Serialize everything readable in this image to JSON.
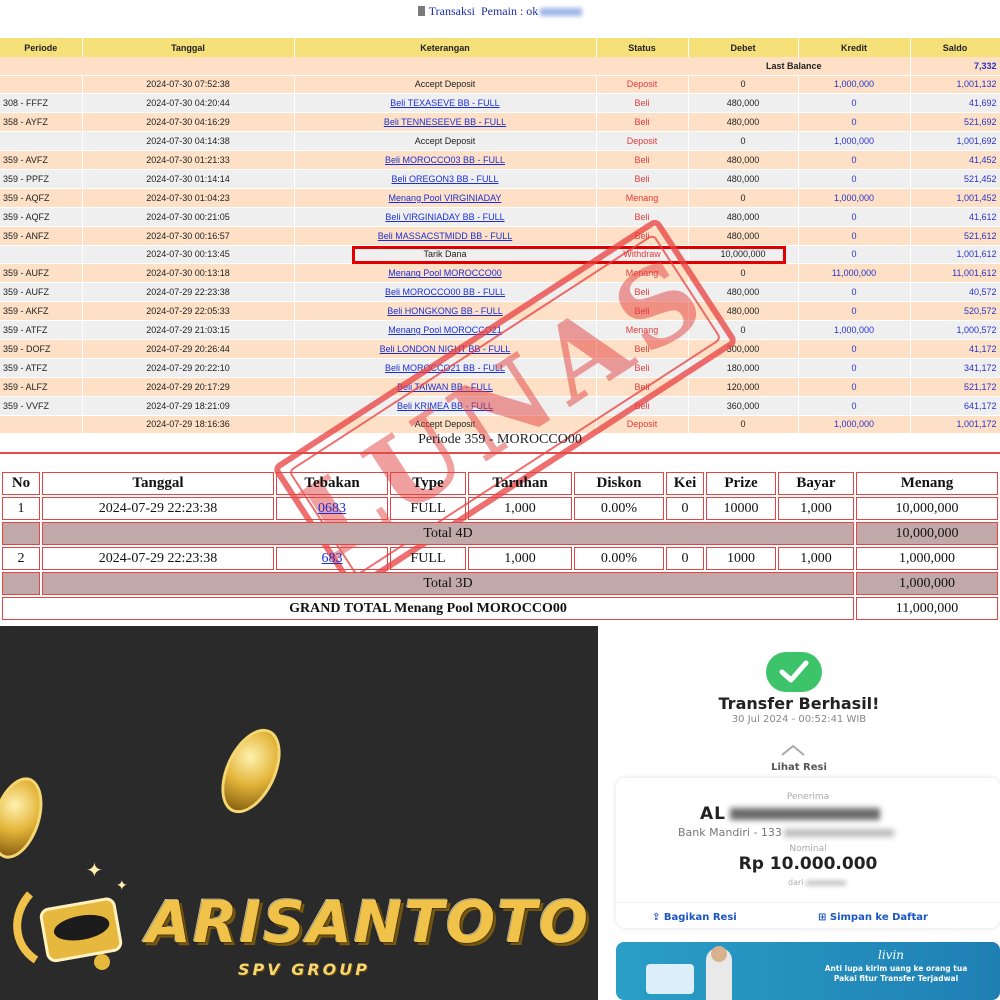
{
  "header": {
    "title": "Transaksi",
    "player_label": "Pemain : ok"
  },
  "ledger": {
    "columns": [
      "Periode",
      "Tanggal",
      "Keterangan",
      "Status",
      "Debet",
      "Kredit",
      "Saldo"
    ],
    "last_balance_label": "Last Balance",
    "last_balance_value": "7,332",
    "rows": [
      {
        "periode": "",
        "tanggal": "2024-07-30 07:52:38",
        "keterangan": "Accept Deposit",
        "link": false,
        "status": "Deposit",
        "debet": "0",
        "kredit": "1,000,000",
        "saldo": "1,001,132"
      },
      {
        "periode": "308 - FFFZ",
        "tanggal": "2024-07-30 04:20:44",
        "keterangan": "Beli TEXASEVE BB - FULL",
        "link": true,
        "status": "Beli",
        "debet": "480,000",
        "kredit": "0",
        "saldo": "41,692"
      },
      {
        "periode": "358 - AYFZ",
        "tanggal": "2024-07-30 04:16:29",
        "keterangan": "Beli TENNESEEVE BB - FULL",
        "link": true,
        "status": "Beli",
        "debet": "480,000",
        "kredit": "0",
        "saldo": "521,692"
      },
      {
        "periode": "",
        "tanggal": "2024-07-30 04:14:38",
        "keterangan": "Accept Deposit",
        "link": false,
        "status": "Deposit",
        "debet": "0",
        "kredit": "1,000,000",
        "saldo": "1,001,692"
      },
      {
        "periode": "359 - AVFZ",
        "tanggal": "2024-07-30 01:21:33",
        "keterangan": "Beli MOROCCO03 BB - FULL",
        "link": true,
        "status": "Beli",
        "debet": "480,000",
        "kredit": "0",
        "saldo": "41,452"
      },
      {
        "periode": "359 - PPFZ",
        "tanggal": "2024-07-30 01:14:14",
        "keterangan": "Beli OREGON3 BB - FULL",
        "link": true,
        "status": "Beli",
        "debet": "480,000",
        "kredit": "0",
        "saldo": "521,452"
      },
      {
        "periode": "359 - AQFZ",
        "tanggal": "2024-07-30 01:04:23",
        "keterangan": "Menang Pool VIRGINIADAY",
        "link": true,
        "status": "Menang",
        "debet": "0",
        "kredit": "1,000,000",
        "saldo": "1,001,452"
      },
      {
        "periode": "359 - AQFZ",
        "tanggal": "2024-07-30 00:21:05",
        "keterangan": "Beli VIRGINIADAY BB - FULL",
        "link": true,
        "status": "Beli",
        "debet": "480,000",
        "kredit": "0",
        "saldo": "41,612"
      },
      {
        "periode": "359 - ANFZ",
        "tanggal": "2024-07-30 00:16:57",
        "keterangan": "Beli MASSACSTMIDD BB - FULL",
        "link": true,
        "status": "Beli",
        "debet": "480,000",
        "kredit": "0",
        "saldo": "521,612"
      },
      {
        "periode": "",
        "tanggal": "2024-07-30 00:13:45",
        "keterangan": "Tarik Dana",
        "link": false,
        "status": "Withdraw",
        "debet": "10,000,000",
        "kredit": "0",
        "saldo": "1,001,612"
      },
      {
        "periode": "359 - AUFZ",
        "tanggal": "2024-07-30 00:13:18",
        "keterangan": "Menang Pool MOROCCO00",
        "link": true,
        "status": "Menang",
        "debet": "0",
        "kredit": "11,000,000",
        "saldo": "11,001,612"
      },
      {
        "periode": "359 - AUFZ",
        "tanggal": "2024-07-29 22:23:38",
        "keterangan": "Beli MOROCCO00 BB - FULL",
        "link": true,
        "status": "Beli",
        "debet": "480,000",
        "kredit": "0",
        "saldo": "40,572"
      },
      {
        "periode": "359 - AKFZ",
        "tanggal": "2024-07-29 22:05:33",
        "keterangan": "Beli HONGKONG BB - FULL",
        "link": true,
        "status": "Beli",
        "debet": "480,000",
        "kredit": "0",
        "saldo": "520,572"
      },
      {
        "periode": "359 - ATFZ",
        "tanggal": "2024-07-29 21:03:15",
        "keterangan": "Menang Pool MOROCCO21",
        "link": true,
        "status": "Menang",
        "debet": "0",
        "kredit": "1,000,000",
        "saldo": "1,000,572"
      },
      {
        "periode": "359 - DOFZ",
        "tanggal": "2024-07-29 20:26:44",
        "keterangan": "Beli LONDON NIGHT BB - FULL",
        "link": true,
        "status": "Beli",
        "debet": "300,000",
        "kredit": "0",
        "saldo": "41,172"
      },
      {
        "periode": "359 - ATFZ",
        "tanggal": "2024-07-29 20:22:10",
        "keterangan": "Beli MOROCCO21 BB - FULL",
        "link": true,
        "status": "Beli",
        "debet": "180,000",
        "kredit": "0",
        "saldo": "341,172"
      },
      {
        "periode": "359 - ALFZ",
        "tanggal": "2024-07-29 20:17:29",
        "keterangan": "Beli TAIWAN BB - FULL",
        "link": true,
        "status": "Beli",
        "debet": "120,000",
        "kredit": "0",
        "saldo": "521,172"
      },
      {
        "periode": "359 - VVFZ",
        "tanggal": "2024-07-29 18:21:09",
        "keterangan": "Beli KRIMEA BB - FULL",
        "link": true,
        "status": "Beli",
        "debet": "360,000",
        "kredit": "0",
        "saldo": "641,172"
      },
      {
        "periode": "",
        "tanggal": "2024-07-29 18:16:36",
        "keterangan": "Accept Deposit",
        "link": false,
        "status": "Deposit",
        "debet": "0",
        "kredit": "1,000,000",
        "saldo": "1,001,172"
      }
    ]
  },
  "periode_caption": "Periode 359 - MOROCCO00",
  "bets": {
    "columns": [
      "No",
      "Tanggal",
      "Tebakan",
      "Type",
      "Taruhan",
      "Diskon",
      "Kei",
      "Prize",
      "Bayar",
      "Menang"
    ],
    "rows": [
      {
        "no": "1",
        "tanggal": "2024-07-29 22:23:38",
        "tebakan": "0683",
        "type": "FULL",
        "taruhan": "1,000",
        "diskon": "0.00%",
        "kei": "0",
        "prize": "10000",
        "bayar": "1,000",
        "menang": "10,000,000"
      },
      {
        "no": "2",
        "tanggal": "2024-07-29 22:23:38",
        "tebakan": "683",
        "type": "FULL",
        "taruhan": "1,000",
        "diskon": "0.00%",
        "kei": "0",
        "prize": "1000",
        "bayar": "1,000",
        "menang": "1,000,000"
      }
    ],
    "total_4d_label": "Total 4D",
    "total_4d_value": "10,000,000",
    "total_3d_label": "Total 3D",
    "total_3d_value": "1,000,000",
    "grand_total_label": "GRAND TOTAL  Menang Pool MOROCCO00",
    "grand_total_value": "11,000,000"
  },
  "stamp": {
    "text": "LUNAS"
  },
  "brand": {
    "name": "ARISANTOTO",
    "sub": "SPV GROUP"
  },
  "transfer": {
    "title": "Transfer Berhasil!",
    "time": "30 Jul 2024 - 00:52:41 WIB",
    "lihat_resi": "Lihat Resi",
    "penerima_label": "Penerima",
    "recipient_name": "AL",
    "recipient_bank": "Bank Mandiri - 133",
    "nominal_label": "Nominal",
    "amount": "Rp 10.000.000",
    "dari_label": "dari",
    "share_label": "Bagikan Resi",
    "save_label": "Simpan ke Daftar",
    "banner_brand": "livin",
    "banner_text": "Anti lupa kirim uang ke orang tua Pakai fitur Transfer Terjadwal"
  },
  "colors": {
    "header_yellow": "#f5e07a",
    "row_peach": "#fde0c6",
    "row_grey": "#efefef",
    "status_red": "#e03b3b",
    "link_blue": "#1a2fd8",
    "highlight_red": "#e00000",
    "success_green": "#3dc46a",
    "brand_gold": "#f0c24a"
  }
}
